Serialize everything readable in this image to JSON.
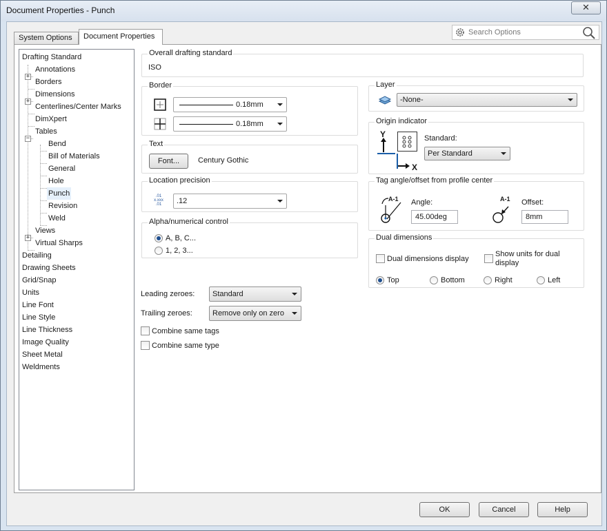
{
  "window": {
    "title": "Document Properties - Punch",
    "close_glyph": "✕"
  },
  "tabs": [
    {
      "label": "System Options"
    },
    {
      "label": "Document Properties"
    }
  ],
  "search": {
    "placeholder": "Search Options"
  },
  "tree": [
    {
      "label": "Drafting Standard"
    },
    {
      "label": "Annotations",
      "expander": "+"
    },
    {
      "label": "Borders"
    },
    {
      "label": "Dimensions",
      "expander": "+"
    },
    {
      "label": "Centerlines/Center Marks"
    },
    {
      "label": "DimXpert"
    },
    {
      "label": "Tables",
      "expander": "−"
    },
    {
      "label": "Bend"
    },
    {
      "label": "Bill of Materials"
    },
    {
      "label": "General"
    },
    {
      "label": "Hole"
    },
    {
      "label": "Punch",
      "selected": true
    },
    {
      "label": "Revision"
    },
    {
      "label": "Weld"
    },
    {
      "label": "Views",
      "expander": "+"
    },
    {
      "label": "Virtual Sharps"
    },
    {
      "label": "Detailing"
    },
    {
      "label": "Drawing Sheets"
    },
    {
      "label": "Grid/Snap"
    },
    {
      "label": "Units"
    },
    {
      "label": "Line Font"
    },
    {
      "label": "Line Style"
    },
    {
      "label": "Line Thickness"
    },
    {
      "label": "Image Quality"
    },
    {
      "label": "Sheet Metal"
    },
    {
      "label": "Weldments"
    }
  ],
  "overall_standard": {
    "title": "Overall drafting standard",
    "value": "ISO"
  },
  "border": {
    "title": "Border",
    "thickness_1": "0.18mm",
    "thickness_2": "0.18mm"
  },
  "text": {
    "title": "Text",
    "font_button": "Font...",
    "font_name": "Century Gothic"
  },
  "location_precision": {
    "title": "Location precision",
    "value": ".12",
    "icon_digits_top": ".01",
    "icon_digits_mid": "x.xxx",
    "icon_digits_bot": ".01"
  },
  "alpha_numerical": {
    "title": "Alpha/numerical control",
    "option_alpha": "A, B, C...",
    "option_numeric": "1, 2, 3...",
    "selected": "alpha"
  },
  "leading_zeroes": {
    "label": "Leading zeroes:",
    "value": "Standard"
  },
  "trailing_zeroes": {
    "label": "Trailing zeroes:",
    "value": "Remove only on zero"
  },
  "combine_same_tags": {
    "label": "Combine same tags",
    "checked": false
  },
  "combine_same_type": {
    "label": "Combine same type",
    "checked": false
  },
  "layer": {
    "title": "Layer",
    "value": "-None-"
  },
  "origin_indicator": {
    "title": "Origin indicator",
    "standard_label": "Standard:",
    "standard_value": "Per Standard",
    "axis_y": "Y",
    "axis_x": "X"
  },
  "tag_angle": {
    "title": "Tag angle/offset from profile center",
    "angle_label": "Angle:",
    "angle_value": "45.00deg",
    "offset_label": "Offset:",
    "offset_value": "8mm",
    "icon_text": "A-1"
  },
  "dual_dimensions": {
    "title": "Dual dimensions",
    "display_label": "Dual dimensions display",
    "show_units_label_1": "Show units for dual",
    "show_units_label_2": "display",
    "top": "Top",
    "bottom": "Bottom",
    "right": "Right",
    "left": "Left",
    "selected": "top"
  },
  "buttons": {
    "ok": "OK",
    "cancel": "Cancel",
    "help": "Help"
  },
  "colors": {
    "accent": "#1f4f8f",
    "window_frame": "#d9e4f0",
    "selection": "#e5f0fb"
  }
}
